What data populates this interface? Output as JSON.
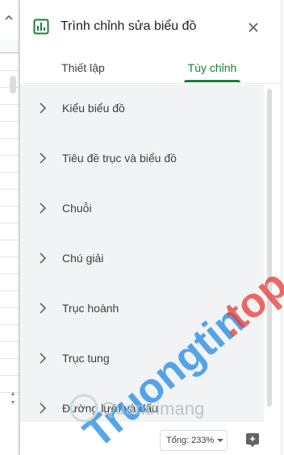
{
  "panel": {
    "title": "Trình chỉnh sửa biểu đồ",
    "close_icon": "close-icon"
  },
  "tabs": [
    {
      "label": "Thiết lập",
      "selected": false
    },
    {
      "label": "Tùy chỉnh",
      "selected": true
    }
  ],
  "sections": [
    {
      "label": "Kiểu biểu đồ"
    },
    {
      "label": "Tiêu đề trục và biểu đồ"
    },
    {
      "label": "Chuỗi"
    },
    {
      "label": "Chú giải"
    },
    {
      "label": "Trục hoành"
    },
    {
      "label": "Trục tung"
    },
    {
      "label": "Đường lưới và dấu"
    }
  ],
  "footer": {
    "sum_label": "Tổng: 233%"
  },
  "watermark": {
    "brand": "Truongtin",
    "domain": ".top",
    "subtext": "Quantrimang"
  },
  "colors": {
    "accent_green": "#188038",
    "panel_bg": "#f1f3f4",
    "watermark_blue": "#1e88e5",
    "watermark_red": "#e53935"
  }
}
